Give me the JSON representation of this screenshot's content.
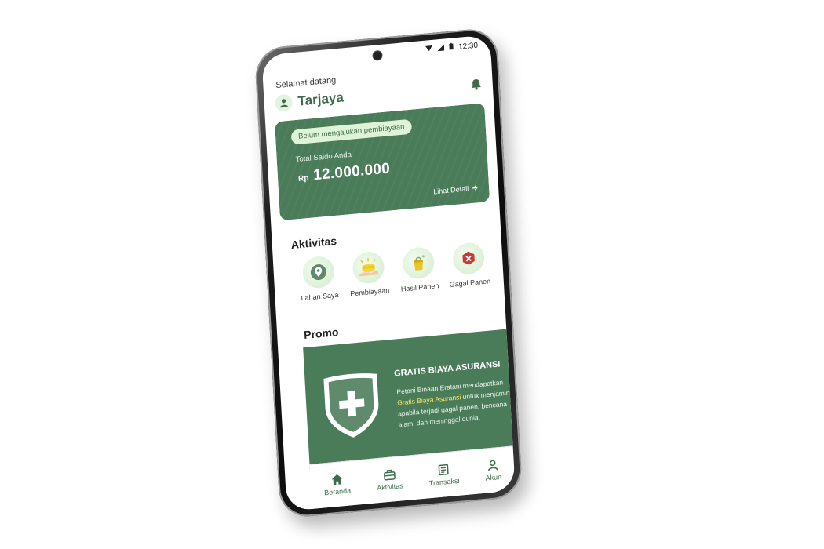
{
  "status_bar": {
    "time": "12:30",
    "wifi_icon": "wifi-icon",
    "signal_icon": "signal-icon",
    "battery_icon": "battery-icon"
  },
  "header": {
    "greeting": "Selamat datang",
    "username": "Tarjaya",
    "avatar_icon": "user-icon",
    "notification_icon": "bell-icon"
  },
  "balance_card": {
    "status_chip": "Belum mengajukan pembiayaan",
    "label": "Total Saldo Anda",
    "currency": "Rp",
    "amount": "12.000.000",
    "detail_link": "Lihat Detail"
  },
  "activities": {
    "title": "Aktivitas",
    "items": [
      {
        "label": "Lahan Saya",
        "icon": "map-pin-icon"
      },
      {
        "label": "Pembiayaan",
        "icon": "coins-icon"
      },
      {
        "label": "Hasil Panen",
        "icon": "harvest-bag-icon"
      },
      {
        "label": "Gagal Panen",
        "icon": "crop-fail-icon"
      }
    ]
  },
  "promo": {
    "title": "Promo",
    "heading": "GRATIS BIAYA ASURANSI",
    "text_before": "Petani Binaan Eratani mendapatkan ",
    "text_highlight": "Gratis Biaya Asuransi",
    "text_after": " untuk menjamin apabila terjadi gagal panen, bencana alam, dan meninggal dunia."
  },
  "bottom_nav": [
    {
      "label": "Beranda",
      "icon": "home-icon"
    },
    {
      "label": "Aktivitas",
      "icon": "briefcase-icon"
    },
    {
      "label": "Transaksi",
      "icon": "receipt-icon"
    },
    {
      "label": "Akun",
      "icon": "user-icon"
    }
  ],
  "colors": {
    "primary_green": "#4b7c5a",
    "text_green": "#3e6b4b",
    "chip_bg": "#dff3d8",
    "highlight": "#ffe566"
  }
}
